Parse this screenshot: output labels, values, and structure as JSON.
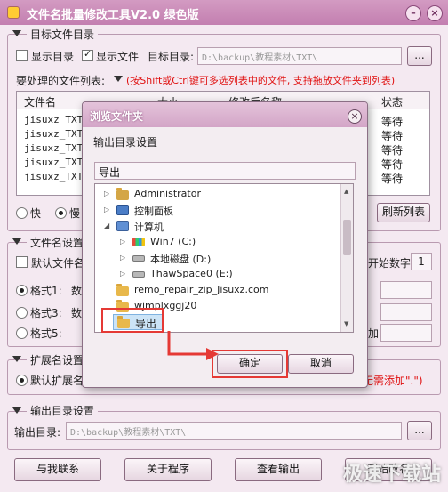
{
  "window": {
    "title": "文件名批量修改工具V2.0  绿色版",
    "minimize_glyph": "–",
    "close_glyph": "×"
  },
  "target_group": {
    "title": "目标文件目录",
    "show_dir_label": "显示目录",
    "show_file_label": "显示文件",
    "target_dir_label": "目标目录:",
    "target_dir_value": "D:\\backup\\教程素材\\TXT\\",
    "browse_label": "...",
    "file_list_label": "要处理的文件列表:",
    "hint": "(按Shift或Ctrl键可多选列表中的文件, 支持拖放文件夹到列表)",
    "columns": [
      "文件名",
      "大小",
      "修改后名称",
      "状态"
    ],
    "rows": [
      {
        "name": "jisuxz_TXT",
        "status": "等待"
      },
      {
        "name": "jisuxz_TXT",
        "status": "等待"
      },
      {
        "name": "jisuxz_TXT",
        "status": "等待"
      },
      {
        "name": "jisuxz_TXT",
        "status": "等待"
      },
      {
        "name": "jisuxz_TXT",
        "status": "等待"
      }
    ],
    "speed_fast": "快",
    "speed_slow": "慢",
    "refresh_label": "刷新列表"
  },
  "rename_group": {
    "title": "文件名设置",
    "default_label": "默认文件名",
    "start_number_label": "开始数字:",
    "start_number_value": "1",
    "format1": "格式1:",
    "format3": "格式3:",
    "format5": "格式5:",
    "truncated_text": "数",
    "add_label": "加"
  },
  "ext_group": {
    "title": "扩展名设置",
    "default_ext": "默认扩展名",
    "hint_tail": "无需添加\".\")"
  },
  "output_group": {
    "title": "输出目录设置",
    "output_label": "输出目录:",
    "output_value": "D:\\backup\\教程素材\\TXT\\",
    "browse_label": "..."
  },
  "footer": {
    "contact": "与我联系",
    "about": "关于程序",
    "view_output": "查看输出",
    "start": "开始改名"
  },
  "dialog": {
    "title": "浏览文件夹",
    "close_glyph": "×",
    "label": "输出目录设置",
    "path_value": "导出",
    "tree": [
      {
        "label": "Administrator",
        "icon": "user-folder-icon",
        "expander": "▷",
        "indent": 0
      },
      {
        "label": "控制面板",
        "icon": "control-panel-icon",
        "expander": "▷",
        "indent": 0
      },
      {
        "label": "计算机",
        "icon": "computer-icon",
        "expander": "◢",
        "indent": 0
      },
      {
        "label": "Win7 (C:)",
        "icon": "windows-drive-icon",
        "expander": "▷",
        "indent": 1
      },
      {
        "label": "本地磁盘 (D:)",
        "icon": "hard-drive-icon",
        "expander": "▷",
        "indent": 1
      },
      {
        "label": "ThawSpace0 (E:)",
        "icon": "hard-drive-icon",
        "expander": "▷",
        "indent": 1
      },
      {
        "label": "remo_repair_zip_Jisuxz.com",
        "icon": "folder-icon",
        "expander": "",
        "indent": 0
      },
      {
        "label": "wjmplxggj20",
        "icon": "folder-icon",
        "expander": "",
        "indent": 0
      },
      {
        "label": "导出",
        "icon": "folder-icon",
        "expander": "",
        "indent": 0,
        "selected": true
      }
    ],
    "ok_label": "确定",
    "cancel_label": "取消"
  },
  "watermark": "极速下载站",
  "colors": {
    "accent": "#c37fb0",
    "hint_red": "#e01010",
    "highlight_red": "#e53935",
    "selection": "#cce4f7"
  }
}
